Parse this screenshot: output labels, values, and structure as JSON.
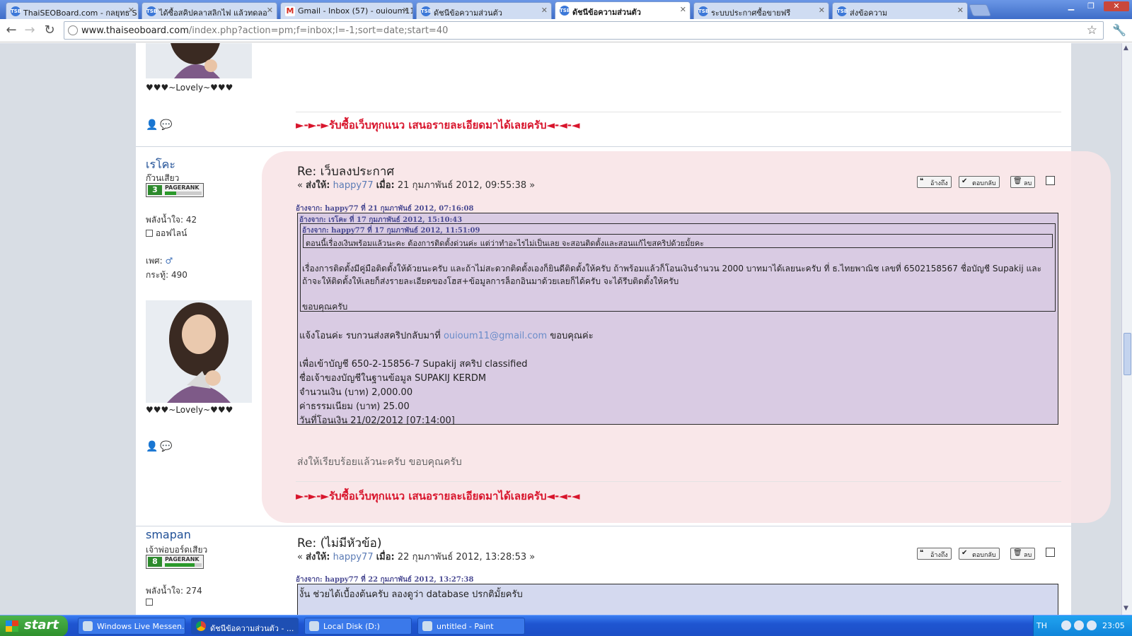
{
  "browser": {
    "tabs": [
      {
        "title": "ThaiSEOBoard.com - กลยุทธ S",
        "favicon": "TSB",
        "active": false
      },
      {
        "title": "ได้ซื้อสคิปคลาสลิกไฟ แล้วทดลอ",
        "favicon": "TSB",
        "active": false
      },
      {
        "title": "Gmail - Inbox (57) - ouioum11",
        "favicon": "M",
        "active": false
      },
      {
        "title": "ดัชนีข้อความส่วนตัว",
        "favicon": "TSB",
        "active": false
      },
      {
        "title": "ดัชนีข้อความส่วนตัว",
        "favicon": "TSB",
        "active": true
      },
      {
        "title": "ระบบประกาศซื้อขายฟรี",
        "favicon": "TSB",
        "active": false
      },
      {
        "title": "ส่งข้อความ",
        "favicon": "TSB",
        "active": false
      }
    ],
    "url_host": "www.thaiseoboard.com",
    "url_path": "/index.php?action=pm;f=inbox;l=-1;sort=date;start=40"
  },
  "posts": {
    "prev": {
      "hearts": "♥♥♥~Lovely~♥♥♥",
      "signature": "►-►-►รับซื้อเว็บทุกแนว เสนอรายละเอียดมาได้เลยครับ◄-◄-◄"
    },
    "main": {
      "author": "เรโคะ",
      "rank": "ก๊วนเสียว",
      "pagerank": "3",
      "pagerank_label": "PAGERANK",
      "pagerank_fill": 0.3,
      "power_label": "พลังน้ำใจ:",
      "power_value": "42",
      "status": "ออฟไลน์",
      "gender_label": "เพศ:",
      "posts_label": "กระทู้:",
      "posts_value": "490",
      "hearts": "♥♥♥~Lovely~♥♥♥",
      "subject": "Re: เว็บลงประกาศ",
      "sent_prefix": "« ",
      "sent_to_label": "ส่งให้:",
      "sent_to": "happy77",
      "when_label": "เมื่อ:",
      "when": "21 กุมภาพันธ์ 2012, 09:55:38 »",
      "btn_quote": "อ้างถึง",
      "btn_reply": "ตอบกลับ",
      "btn_delete": "ลบ",
      "quote1_head": "อ้างจาก: happy77 ที่ 21 กุมภาพันธ์ 2012, 07:16:08",
      "quote2_head": "อ้างจาก: เรโคะ ที่ 17 กุมภาพันธ์ 2012, 15:10:43",
      "quote3_head": "อ้างจาก: happy77 ที่ 17 กุมภาพันธ์ 2012, 11:51:09",
      "quote3_text": "ตอนนี้เรื่องเงินพร้อมแล้วนะคะ  ต้องการติดตั้งด่วนค่ะ แต่ว่าทำอะไรไม่เป็นเลย จะสอนติดตั้งและสอนแก้ไขสคริปด้วยมั้ยคะ",
      "quote2_line1": "เรื่องการติดตั้งมีคู่มือติดตั้งให้ด้วยนะครับ และถ้าไม่สะดวกติดตั้งเองก็ยินดีติดตั้งให้ครับ ถ้าพร้อมแล้วก็โอนเงินจำนวน 2000 บาทมาได้เลยนะครับ ที่ ธ.ไทยพาณิช เลขที่ 6502158567 ชื่อบัญชี Supakij  และ",
      "quote2_line2": "ถ้าจะให้ติดตั้งให้เลยก็ส่งรายละเอียดของโฮส+ข้อมูลการล็อกอินมาด้วยเลยก็ได้ครับ จะได้รีบติดตั้งให้ครับ",
      "quote2_thanks": "ขอบคุณครับ",
      "q1_notice": "แจ้งโอนค่ะ รบกวนส่งสคริปกลับมาที่",
      "q1_email": "ouioum11@gmail.com",
      "q1_notice_end": "ขอบคุณค่ะ",
      "q1_account": "เพื่อเข้าบัญชี   650-2-15856-7 Supakij สคริป classified",
      "q1_owner": "ชื่อเจ้าของบัญชีในฐานข้อมูล   SUPAKIJ KERDM",
      "q1_amount": "จำนวนเงิน (บาท)    2,000.00",
      "q1_fee": "ค่าธรรมเนียม (บาท)    25.00",
      "q1_date": "วันที่โอนเงิน   21/02/2012 [07:14:00]",
      "reply_text": "ส่งให้เรียบร้อยแล้วนะครับ ขอบคุณครับ",
      "signature": "►-►-►รับซื้อเว็บทุกแนว เสนอรายละเอียดมาได้เลยครับ◄-◄-◄"
    },
    "next": {
      "author": "smapan",
      "rank": "เจ้าพ่อบอร์ดเสียว",
      "pagerank": "8",
      "pagerank_label": "PAGERANK",
      "pagerank_fill": 0.8,
      "power_label": "พลังน้ำใจ:",
      "power_value": "274",
      "subject": "Re: (ไม่มีหัวข้อ)",
      "sent_prefix": "« ",
      "sent_to_label": "ส่งให้:",
      "sent_to": "happy77",
      "when_label": "เมื่อ:",
      "when": "22 กุมภาพันธ์ 2012, 13:28:53 »",
      "btn_quote": "อ้างถึง",
      "btn_reply": "ตอบกลับ",
      "btn_delete": "ลบ",
      "quote_head": "อ้างจาก: happy77 ที่ 22 กุมภาพันธ์ 2012, 13:27:38",
      "quote_text": "งั้น ช่วยได้เบื้องต้นครับ ลองดูว่า database ปรกติมั้ยครับ"
    }
  },
  "taskbar": {
    "start": "start",
    "items": [
      {
        "label": "Windows Live Messen...",
        "active": false
      },
      {
        "label": "ดัชนีข้อความส่วนตัว - ...",
        "active": true
      },
      {
        "label": "Local Disk (D:)",
        "active": false
      },
      {
        "label": "untitled - Paint",
        "active": false
      }
    ],
    "lang": "TH",
    "clock": "23:05"
  }
}
